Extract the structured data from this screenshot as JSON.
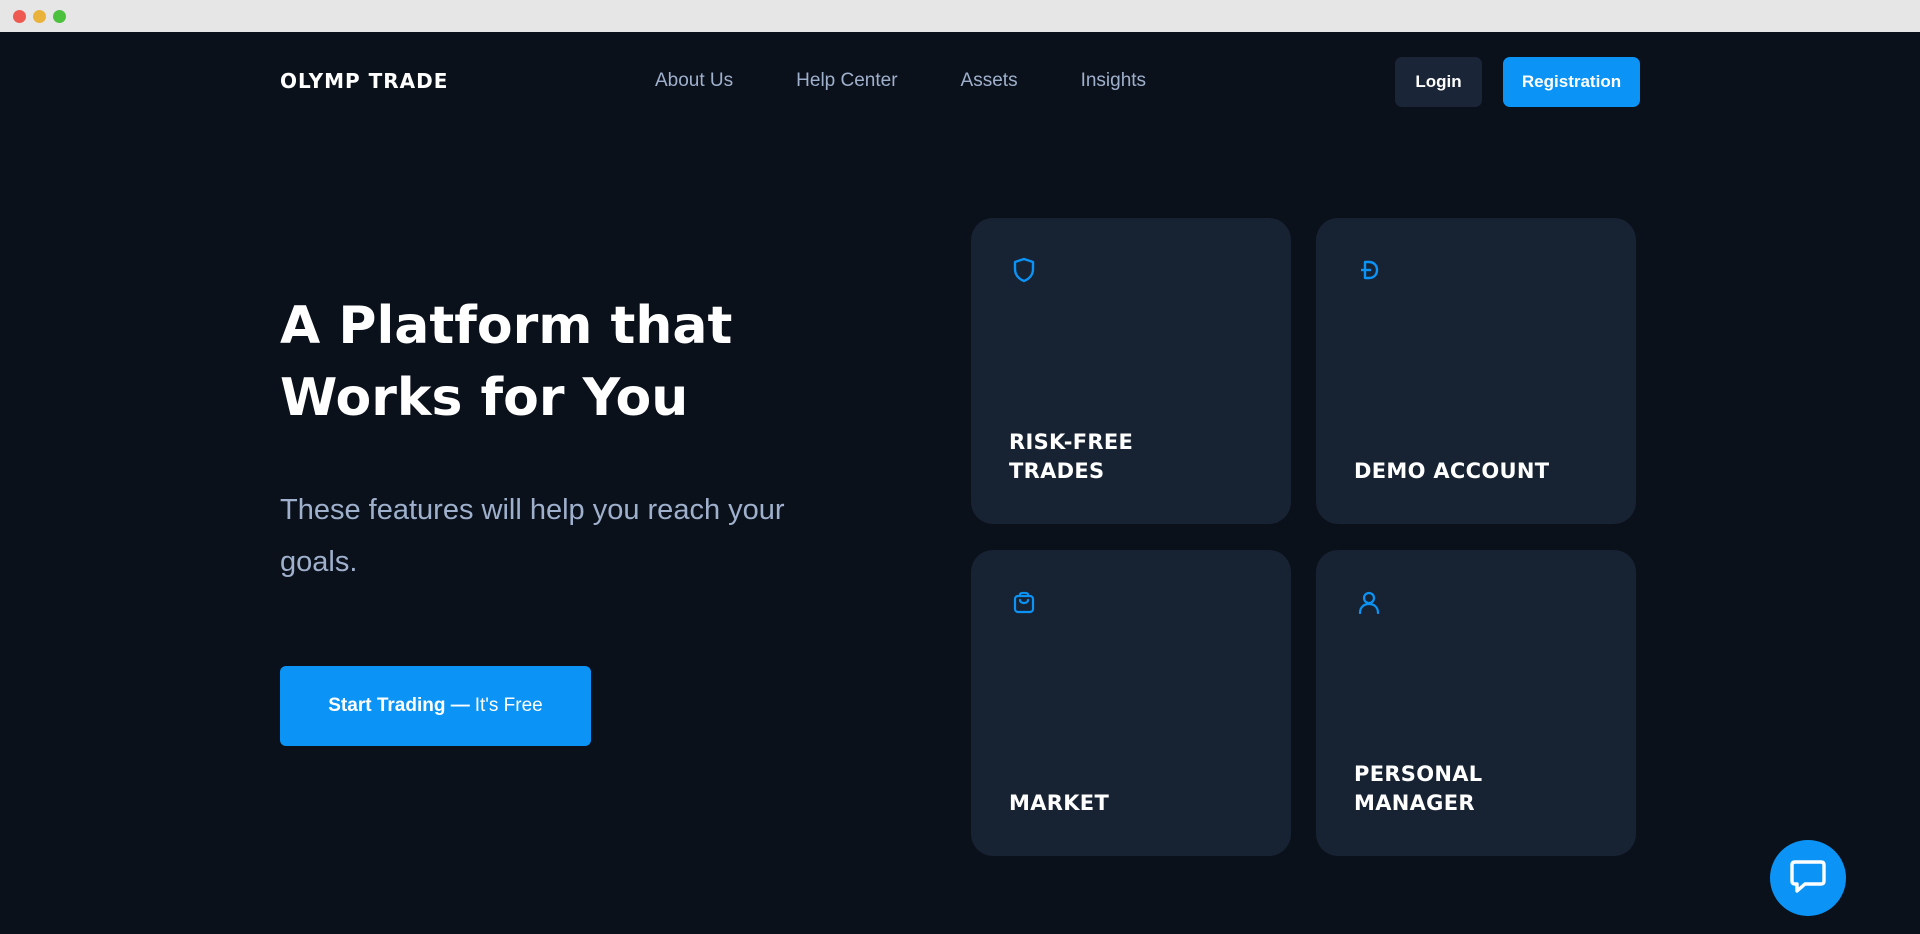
{
  "brand": {
    "name": "OLYMP TRADE",
    "accent": "#0b94f5",
    "background": "#0b111b",
    "card_bg": "#172233"
  },
  "header": {
    "nav": [
      "About Us",
      "Help Center",
      "Assets",
      "Insights"
    ],
    "login_label": "Login",
    "registration_label": "Registration"
  },
  "hero": {
    "title_line1": "A Platform that",
    "title_line2": "Works for You",
    "subtitle": "These features will help you reach your goals.",
    "cta_strong": "Start Trading —",
    "cta_light": "It's Free"
  },
  "features": [
    {
      "icon": "shield-icon",
      "lines": [
        "RISK-FREE",
        "TRADES"
      ]
    },
    {
      "icon": "demo-coin-icon",
      "lines": [
        "DEMO ACCOUNT"
      ]
    },
    {
      "icon": "shopping-bag-icon",
      "lines": [
        "MARKET"
      ]
    },
    {
      "icon": "user-icon",
      "lines": [
        "PERSONAL",
        "MANAGER"
      ]
    }
  ],
  "chat": {
    "icon": "chat-bubble-icon"
  }
}
